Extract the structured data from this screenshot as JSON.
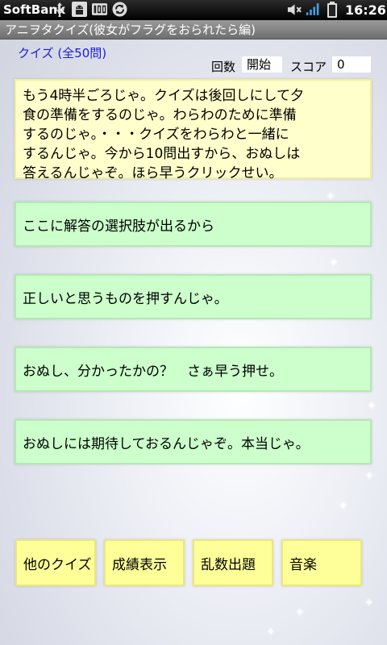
{
  "status_bar": {
    "carrier": "SoftBank",
    "time": "16:26",
    "icons_left": [
      "usb-icon",
      "android-debug-icon",
      "sd-card-icon",
      "sync-icon"
    ],
    "icons_right": [
      "mute-icon",
      "signal-icon",
      "battery-icon"
    ]
  },
  "app": {
    "title": "アニヲタクイズ(彼女がフラグをおられたら編)"
  },
  "quiz": {
    "count_label": "クイズ (全50問)",
    "round_label": "回数",
    "round_value": "開始",
    "score_label": "スコア",
    "score_value": "0"
  },
  "message": {
    "lines": [
      "もう4時半ごろじゃ。クイズは後回しにして夕",
      "食の準備をするのじゃ。わらわのために準備",
      "するのじゃ。・・・クイズをわらわと一緒に",
      "するんじゃ。今から10問出すから、おぬしは",
      "答えるんじゃぞ。ほら早うクリックせい。"
    ]
  },
  "answers": [
    "ここに解答の選択肢が出るから",
    "正しいと思うものを押すんじゃ。",
    "おぬし、分かったかの？　さぁ早う押せ。",
    "おぬしには期待しておるんじゃぞ。本当じゃ。"
  ],
  "menu": {
    "other_quiz": "他のクイズ",
    "show_results": "成績表示",
    "random_quiz": "乱数出題",
    "music": "音楽"
  },
  "colors": {
    "message_bg": "#ffffcc",
    "answer_bg": "#ccffcc",
    "menu_bg": "#ffff99",
    "count_label": "#1d1bd6"
  }
}
